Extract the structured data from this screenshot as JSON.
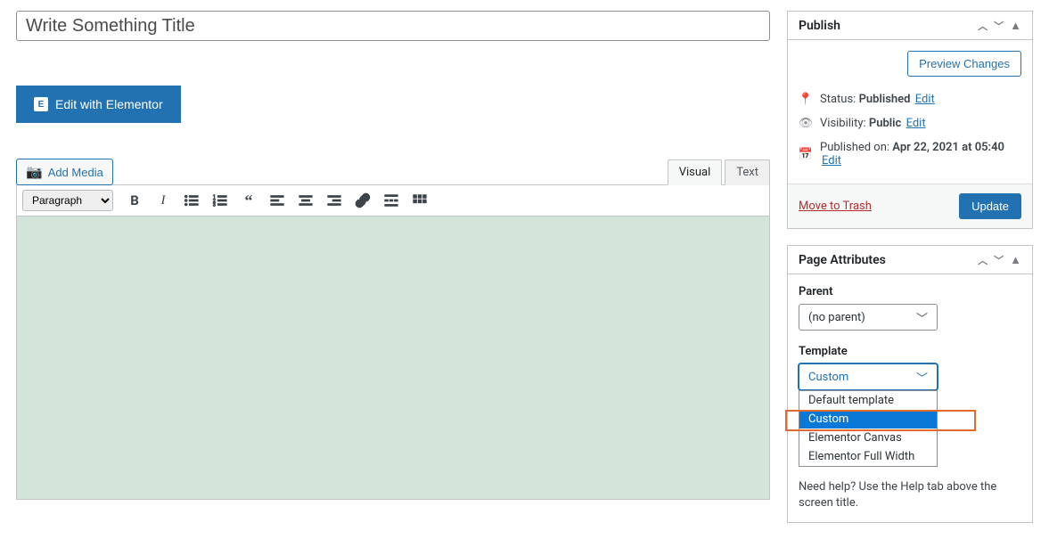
{
  "title": {
    "value": "Write Something Title"
  },
  "elementor": {
    "button_label": "Edit with Elementor",
    "icon_glyph": "E"
  },
  "media": {
    "add_label": "Add Media"
  },
  "tabs": {
    "visual": "Visual",
    "text": "Text"
  },
  "format_select": "Paragraph",
  "publish": {
    "header": "Publish",
    "preview_label": "Preview Changes",
    "status_label": "Status:",
    "status_value": "Published",
    "visibility_label": "Visibility:",
    "visibility_value": "Public",
    "published_label": "Published on:",
    "published_value": "Apr 22, 2021 at 05:40",
    "edit_label": "Edit",
    "trash_label": "Move to Trash",
    "update_label": "Update"
  },
  "attributes": {
    "header": "Page Attributes",
    "parent_label": "Parent",
    "parent_value": "(no parent)",
    "template_label": "Template",
    "template_value": "Custom",
    "options": {
      "default": "Default template",
      "custom": "Custom",
      "canvas": "Elementor Canvas",
      "full": "Elementor Full Width"
    },
    "help_text": "Need help? Use the Help tab above the screen title."
  }
}
